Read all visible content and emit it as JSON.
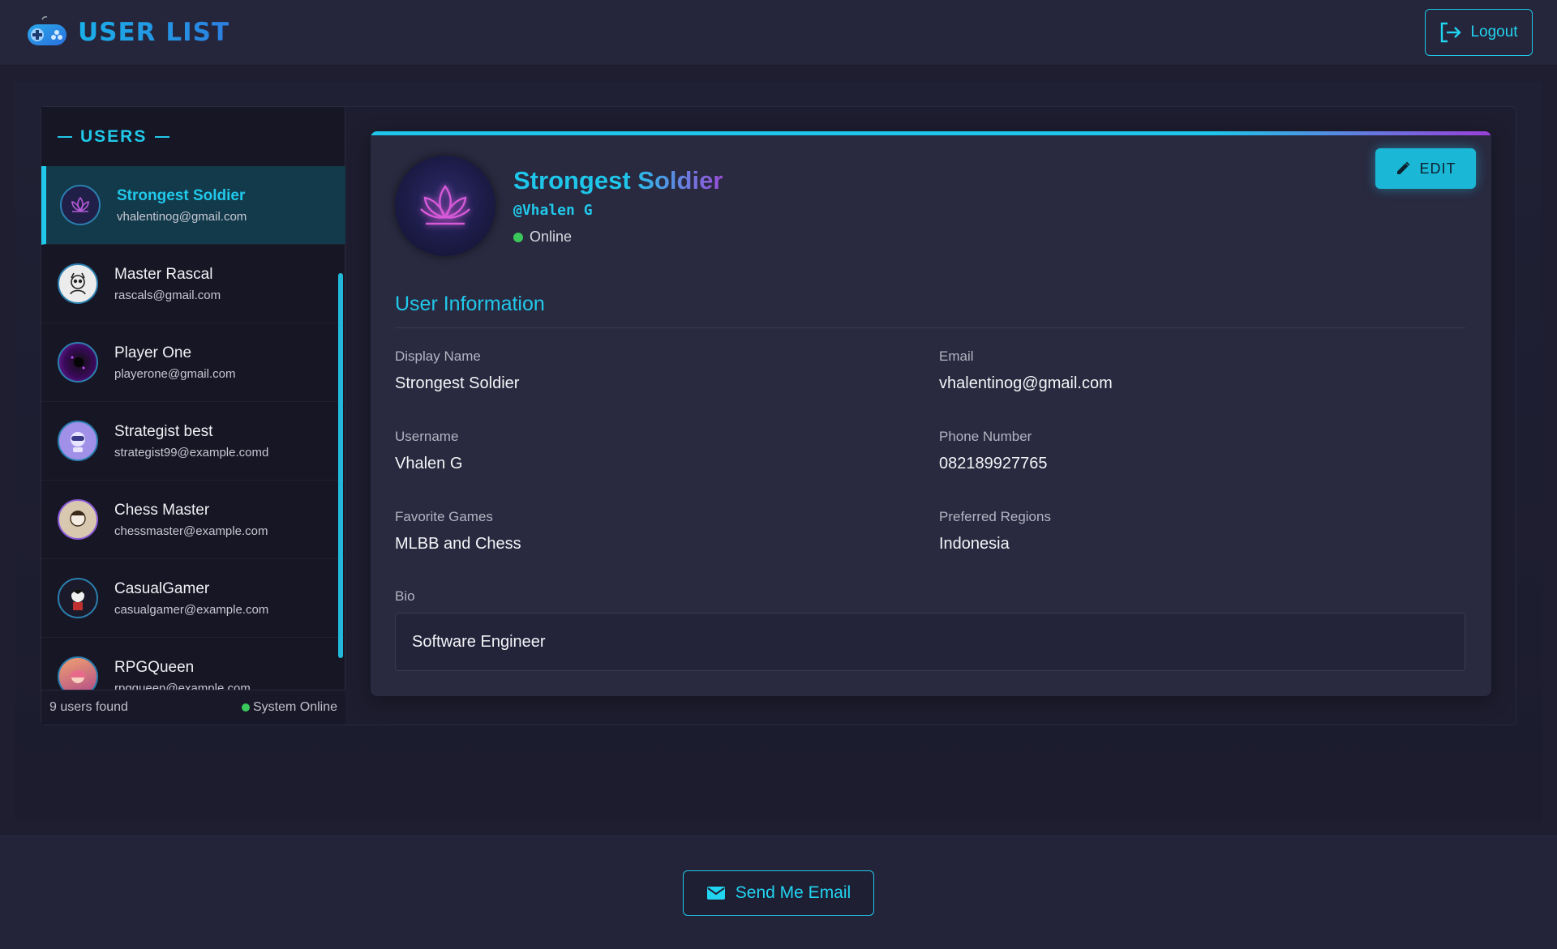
{
  "header": {
    "title": "USER LIST",
    "logout_label": "Logout"
  },
  "sidebar": {
    "title": "USERS",
    "users": [
      {
        "name": "Strongest Soldier",
        "email": "vhalentinog@gmail.com",
        "active": true,
        "avatar_color": "#1f1f48"
      },
      {
        "name": "Master Rascal",
        "email": "rascals@gmail.com",
        "active": false,
        "avatar_color": "#e8e8e8"
      },
      {
        "name": "Player One",
        "email": "playerone@gmail.com",
        "active": false,
        "avatar_color": "#2a0a3a"
      },
      {
        "name": "Strategist best",
        "email": "strategist99@example.comd",
        "active": false,
        "avatar_color": "#a090e8"
      },
      {
        "name": "Chess Master",
        "email": "chessmaster@example.com",
        "active": false,
        "avatar_color": "#d8c8b0"
      },
      {
        "name": "CasualGamer",
        "email": "casualgamer@example.com",
        "active": false,
        "avatar_color": "#1a1a2a"
      },
      {
        "name": "RPGQueen",
        "email": "rpgqueen@example.com",
        "active": false,
        "avatar_color": "#c86060"
      }
    ],
    "footer": {
      "count_text": "9 users found",
      "system_status": "System Online"
    }
  },
  "profile": {
    "name": "Strongest Soldier",
    "handle": "@Vhalen G",
    "status": "Online",
    "edit_label": "EDIT",
    "section_title": "User Information",
    "fields": {
      "display_name": {
        "label": "Display Name",
        "value": "Strongest Soldier"
      },
      "email": {
        "label": "Email",
        "value": "vhalentinog@gmail.com"
      },
      "username": {
        "label": "Username",
        "value": "Vhalen G"
      },
      "phone": {
        "label": "Phone Number",
        "value": "082189927765"
      },
      "favorite_games": {
        "label": "Favorite Games",
        "value": "MLBB and Chess"
      },
      "preferred_regions": {
        "label": "Preferred Regions",
        "value": "Indonesia"
      },
      "bio": {
        "label": "Bio",
        "value": "Software Engineer"
      }
    }
  },
  "footer": {
    "email_button_label": "Send Me Email"
  },
  "colors": {
    "accent": "#21c8ea",
    "accent_purple": "#9a4ed8",
    "online": "#3bc85a",
    "background": "#1e1e30"
  },
  "icons": {
    "brand": "gamepad-icon",
    "logout": "logout-icon",
    "edit": "pencil-icon",
    "avatar": "lotus-icon",
    "email": "envelope-icon"
  }
}
